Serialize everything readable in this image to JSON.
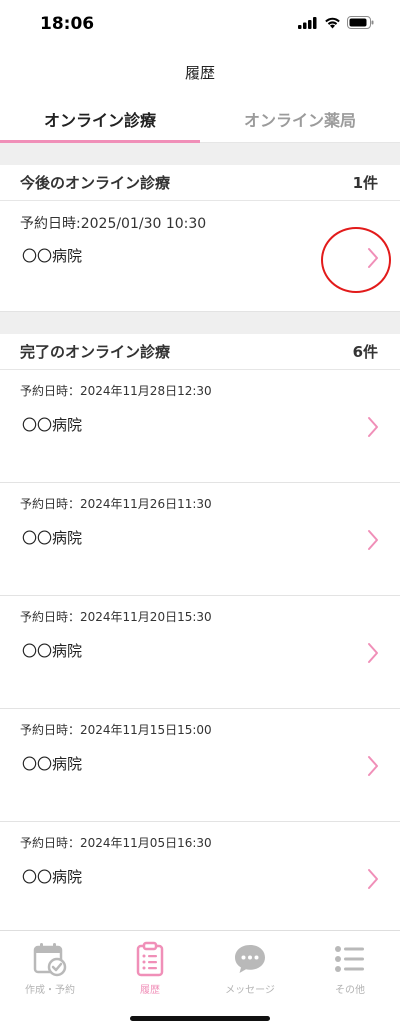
{
  "status_bar": {
    "time": "18:06"
  },
  "header": {
    "title": "履歴"
  },
  "tabs": [
    {
      "label": "オンライン診療",
      "active": true
    },
    {
      "label": "オンライン薬局",
      "active": false
    }
  ],
  "upcoming": {
    "title": "今後のオンライン診療",
    "count": "1件",
    "items": [
      {
        "date": "予約日時:2025/01/30  10:30",
        "hospital": "〇〇病院"
      }
    ]
  },
  "completed": {
    "title": "完了のオンライン診療",
    "count": "6件",
    "items": [
      {
        "date": "予約日時：2024年11月28日12:30",
        "hospital": "〇〇病院"
      },
      {
        "date": "予約日時：2024年11月26日11:30",
        "hospital": "〇〇病院"
      },
      {
        "date": "予約日時：2024年11月20日15:30",
        "hospital": "〇〇病院"
      },
      {
        "date": "予約日時：2024年11月15日15:00",
        "hospital": "〇〇病院"
      },
      {
        "date": "予約日時：2024年11月05日16:30",
        "hospital": "〇〇病院"
      }
    ]
  },
  "tabbar": {
    "items": [
      {
        "label": "作成・予約",
        "icon": "calendar-check-icon"
      },
      {
        "label": "履歴",
        "icon": "clipboard-list-icon"
      },
      {
        "label": "メッセージ",
        "icon": "chat-bubble-icon"
      },
      {
        "label": "その他",
        "icon": "list-icon"
      }
    ]
  },
  "colors": {
    "accent": "#f08fb8",
    "highlight": "#e21b1b",
    "inactive": "#b3b3b3"
  }
}
